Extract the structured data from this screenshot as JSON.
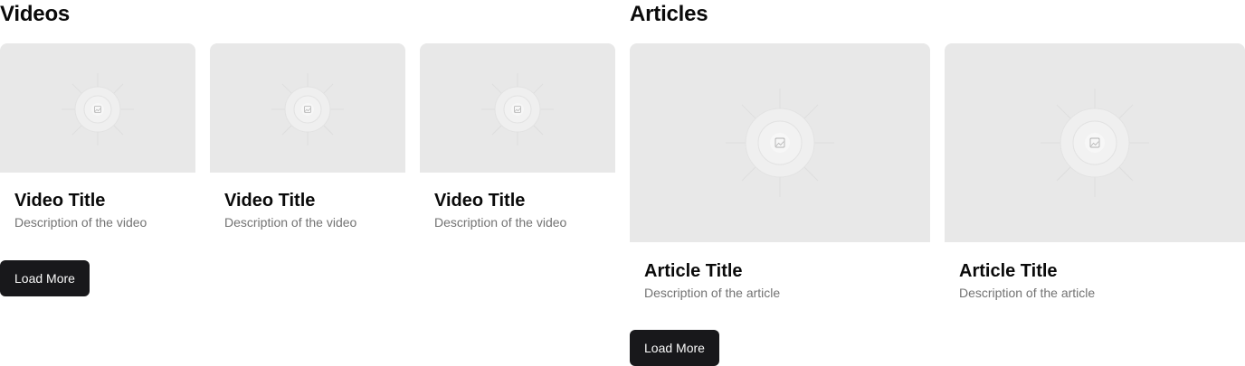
{
  "videos": {
    "title": "Videos",
    "items": [
      {
        "title": "Video Title",
        "description": "Description of the video"
      },
      {
        "title": "Video Title",
        "description": "Description of the video"
      },
      {
        "title": "Video Title",
        "description": "Description of the video"
      }
    ],
    "load_more_label": "Load More"
  },
  "articles": {
    "title": "Articles",
    "items": [
      {
        "title": "Article Title",
        "description": "Description of the article"
      },
      {
        "title": "Article Title",
        "description": "Description of the article"
      }
    ],
    "load_more_label": "Load More"
  },
  "colors": {
    "placeholder_bg": "#e8e8e8",
    "button_bg": "#18181b",
    "button_text": "#fafafa",
    "muted_text": "#737373"
  },
  "icons": {
    "thumbnail": "image-placeholder-icon"
  }
}
